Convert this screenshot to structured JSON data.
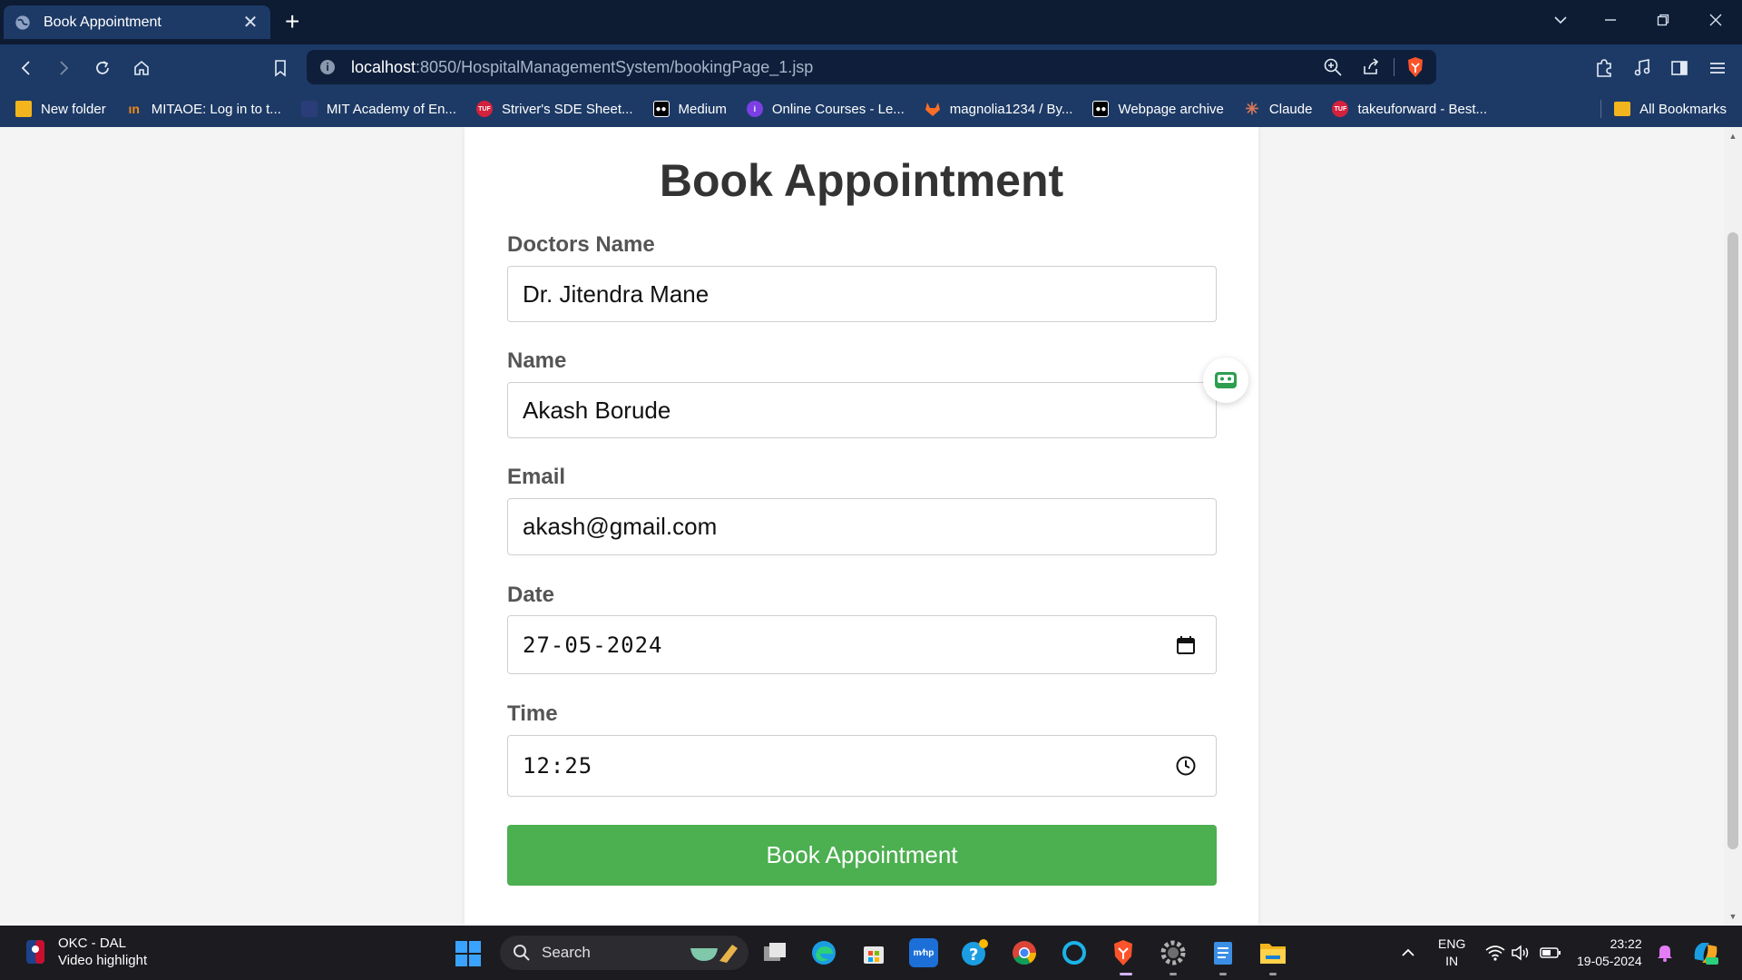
{
  "browser": {
    "tab_title": "Book Appointment",
    "url_host": "localhost",
    "url_rest": ":8050/HospitalManagementSystem/bookingPage_1.jsp",
    "accent": "#1d3a66"
  },
  "bookmarks": {
    "items": [
      {
        "label": "New folder",
        "icon": "folder-icon"
      },
      {
        "label": "MITAOE: Log in to t...",
        "icon": "mitaoe-icon"
      },
      {
        "label": "MIT Academy of En...",
        "icon": "mit-icon"
      },
      {
        "label": "Striver's SDE Sheet...",
        "icon": "tuf-icon"
      },
      {
        "label": "Medium",
        "icon": "medium-icon"
      },
      {
        "label": "Online Courses - Le...",
        "icon": "courses-icon"
      },
      {
        "label": "magnolia1234 / By...",
        "icon": "gitlab-icon"
      },
      {
        "label": "Webpage archive",
        "icon": "archive-icon"
      },
      {
        "label": "Claude",
        "icon": "claude-icon"
      },
      {
        "label": "takeuforward - Best...",
        "icon": "tuf-icon"
      }
    ],
    "all_label": "All Bookmarks"
  },
  "page": {
    "heading": "Book Appointment",
    "fields": {
      "doctor": {
        "label": "Doctors Name",
        "value": "Dr. Jitendra Mane"
      },
      "name": {
        "label": "Name",
        "value": "Akash Borude"
      },
      "email": {
        "label": "Email",
        "value": "akash@gmail.com"
      },
      "date": {
        "label": "Date",
        "value": "27-05-2024"
      },
      "time": {
        "label": "Time",
        "value": "12:25"
      }
    },
    "submit_label": "Book Appointment",
    "submit_color": "#4caf50"
  },
  "taskbar": {
    "widget_title": "OKC - DAL",
    "widget_subtitle": "Video highlight",
    "search_label": "Search",
    "lang_line1": "ENG",
    "lang_line2": "IN",
    "time": "23:22",
    "date": "19-05-2024"
  }
}
